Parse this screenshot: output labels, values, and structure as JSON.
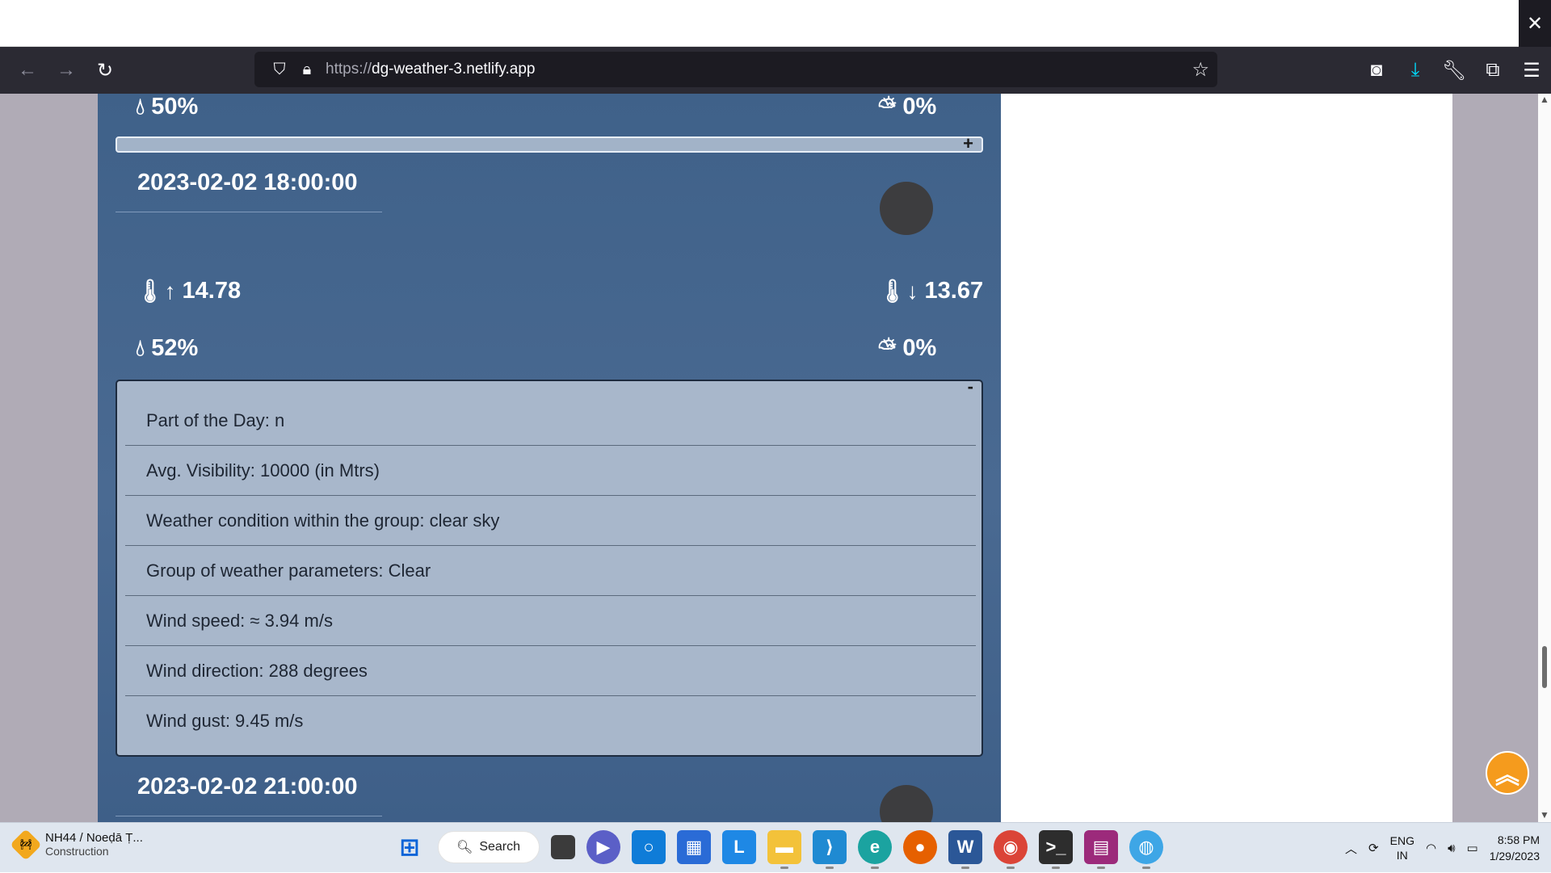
{
  "browser": {
    "url_protocol": "https://",
    "url_host": "dg-weather-3.netlify.app"
  },
  "forecast": {
    "prev": {
      "humidity": "50%",
      "clouds": "0%"
    },
    "current": {
      "datetime": "2023-02-02 18:00:00",
      "temp_max": "14.78",
      "temp_min": "13.67",
      "humidity": "52%",
      "clouds": "0%",
      "details": [
        "Part of the Day: n",
        "Avg. Visibility: 10000 (in Mtrs)",
        "Weather condition within the group: clear sky",
        "Group of weather parameters: Clear",
        "Wind speed: ≈ 3.94 m/s",
        "Wind direction: 288 degrees",
        "Wind gust:  9.45 m/s"
      ]
    },
    "next": {
      "datetime": "2023-02-02 21:00:00"
    },
    "expand_label": "+",
    "collapse_label": "-"
  },
  "taskbar": {
    "news_title": "NH44 / Noeḍā Ṭ...",
    "news_subtitle": "Construction",
    "search_label": "Search",
    "lang_top": "ENG",
    "lang_bottom": "IN",
    "time": "8:58 PM",
    "date": "1/29/2023"
  }
}
